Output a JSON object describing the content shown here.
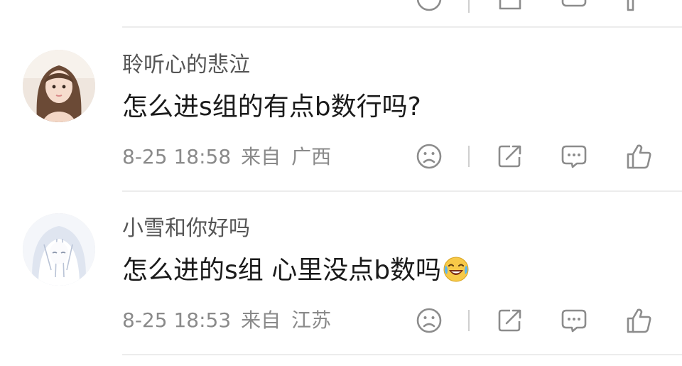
{
  "comments": [
    {
      "username": "",
      "content": "",
      "time": "",
      "location_prefix": "",
      "location": "江苏"
    },
    {
      "username": "聆听心的悲泣",
      "content": "怎么进s组的有点b数行吗?",
      "time": "8-25 18:58",
      "location_prefix": "来自",
      "location": "广西"
    },
    {
      "username": "小雪和你好吗",
      "content": "怎么进的s组 心里没点b数吗",
      "content_emoji": "laughing-crying-emoji",
      "time": "8-25 18:53",
      "location_prefix": "来自",
      "location": "江苏"
    }
  ],
  "icons": {
    "dislike": "frown-face-icon",
    "share": "share-icon",
    "reply": "comment-icon",
    "like": "thumbs-up-icon"
  },
  "colors": {
    "icon": "#8c8c8c",
    "meta_text": "#8a8a8a",
    "username": "#555555",
    "content": "#1a1a1a"
  }
}
